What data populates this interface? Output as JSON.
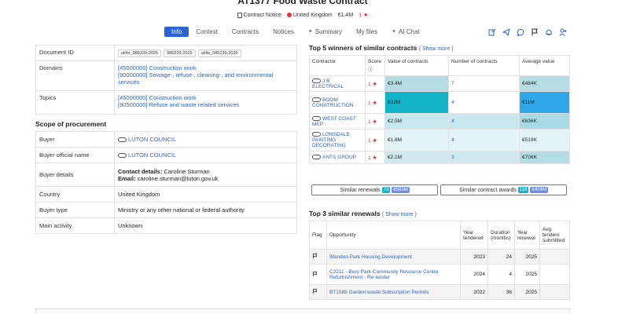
{
  "header": {
    "title": "AT1377 Food Waste Contract",
    "doc_type": "Contract Notice",
    "country": "United Kingdom",
    "value": "€1.4M",
    "rating": "1"
  },
  "tabs": [
    {
      "label": "Info",
      "active": true
    },
    {
      "label": "Context"
    },
    {
      "label": "Contracts"
    },
    {
      "label": "Notices"
    },
    {
      "label": "Summary"
    },
    {
      "label": "My files"
    },
    {
      "label": "AI Chat"
    }
  ],
  "info": {
    "document_id_label": "Document ID",
    "document_ids": [
      "ukfts_085239-2025",
      "085239-2025",
      "ukfts_085239-2025"
    ],
    "domains_label": "Domains",
    "domains": [
      "[45000000] Construction work",
      "[90000000] Sewage-, refuse-, cleaning-, and environmental services"
    ],
    "topics_label": "Topics",
    "topics": [
      "[45000000] Construction work",
      "[90500000] Refuse and waste related services"
    ]
  },
  "scope": {
    "heading": "Scope of procurement",
    "buyer_label": "Buyer",
    "buyer": "LUTON COUNCIL",
    "buyer_official_label": "Buyer official name",
    "buyer_official": "LUTON COUNCIL",
    "buyer_details_label": "Buyer details",
    "contact_label": "Contact details:",
    "contact_name": "Caroline Sturman",
    "email_label": "Email:",
    "email": "caroline.sturman@luton.gov.uk",
    "country_label": "Country",
    "country": "United Kingdom",
    "buyer_type_label": "Buyer type",
    "buyer_type": "Ministry or any other national or federal authority",
    "main_activity_label": "Main activity",
    "main_activity": "Unknown"
  },
  "winners": {
    "heading": "Top 5 winners of similar contracts",
    "show_more": "Show more",
    "columns": [
      "Contractor",
      "Score",
      "Value of contracts",
      "Number of contracts",
      "Average value"
    ],
    "rows": [
      {
        "name": "J B ELECTRICAL",
        "score": "1",
        "value": "€3.4M",
        "count": "7",
        "avg": "€484K",
        "cv": "#b6dde6",
        "cc": "#ffffff",
        "ca": "#b6dde6"
      },
      {
        "name": "BOOM CONSTRUCTION",
        "score": "1",
        "value": "€32M",
        "count": "4",
        "avg": "€11M",
        "cv": "#13b3c8",
        "cc": "#ffffff",
        "ca": "#2fa7e8"
      },
      {
        "name": "WEST COAST MEP",
        "score": "1",
        "value": "€2.5M",
        "count": "4",
        "avg": "€636K",
        "cv": "#c9e7ee",
        "cc": "#c9e7ee",
        "ca": "#a9dbe6"
      },
      {
        "name": "LONSDALE PAINTING DECORATING",
        "score": "1",
        "value": "€1.6M",
        "count": "4",
        "avg": "€519K",
        "cv": "#e2f4f8",
        "cc": "#e2f4f8",
        "ca": "#e2f4f8"
      },
      {
        "name": "ANTS GROUP",
        "score": "1",
        "value": "€2.1M",
        "count": "3",
        "avg": "€706K",
        "cv": "#cfe9ef",
        "cc": "#cfe9ef",
        "ca": "#b6dde6"
      }
    ]
  },
  "similar": {
    "renewals_label": "Similar renewals",
    "renewals_count": "73",
    "renewals_value": "€583M",
    "awards_label": "Similar contract awards",
    "awards_count": "116",
    "awards_value": "€404M"
  },
  "renewals": {
    "heading": "Top 3 similar renewals",
    "show_more": "Show more",
    "columns": [
      "Flag",
      "Opportunity",
      "Year tendered",
      "Duration (months)",
      "Year renewal",
      "Avg tenders submitted"
    ],
    "rows": [
      {
        "opportunity": "Wandon Park Housing Development",
        "year": "2023",
        "duration": "24",
        "renewal": "2025",
        "avg": ""
      },
      {
        "opportunity": "C2211 - Bury Park Community Resource Centre Refurbishment - Re-tender",
        "year": "2024",
        "duration": "4",
        "renewal": "2025",
        "avg": ""
      },
      {
        "opportunity": "BT1585 Garden waste Subscription Permits",
        "year": "2022",
        "duration": "36",
        "renewal": "2025",
        "avg": ""
      }
    ]
  },
  "colors": {
    "accent": "#2c63d6",
    "star": "#d42f3a",
    "badge_teal": "#16b3c8",
    "badge_blue": "#6d8ef0"
  },
  "icons": [
    "edit-icon",
    "share-icon",
    "comment-icon",
    "flag-icon",
    "bell-icon",
    "add-user-icon"
  ]
}
